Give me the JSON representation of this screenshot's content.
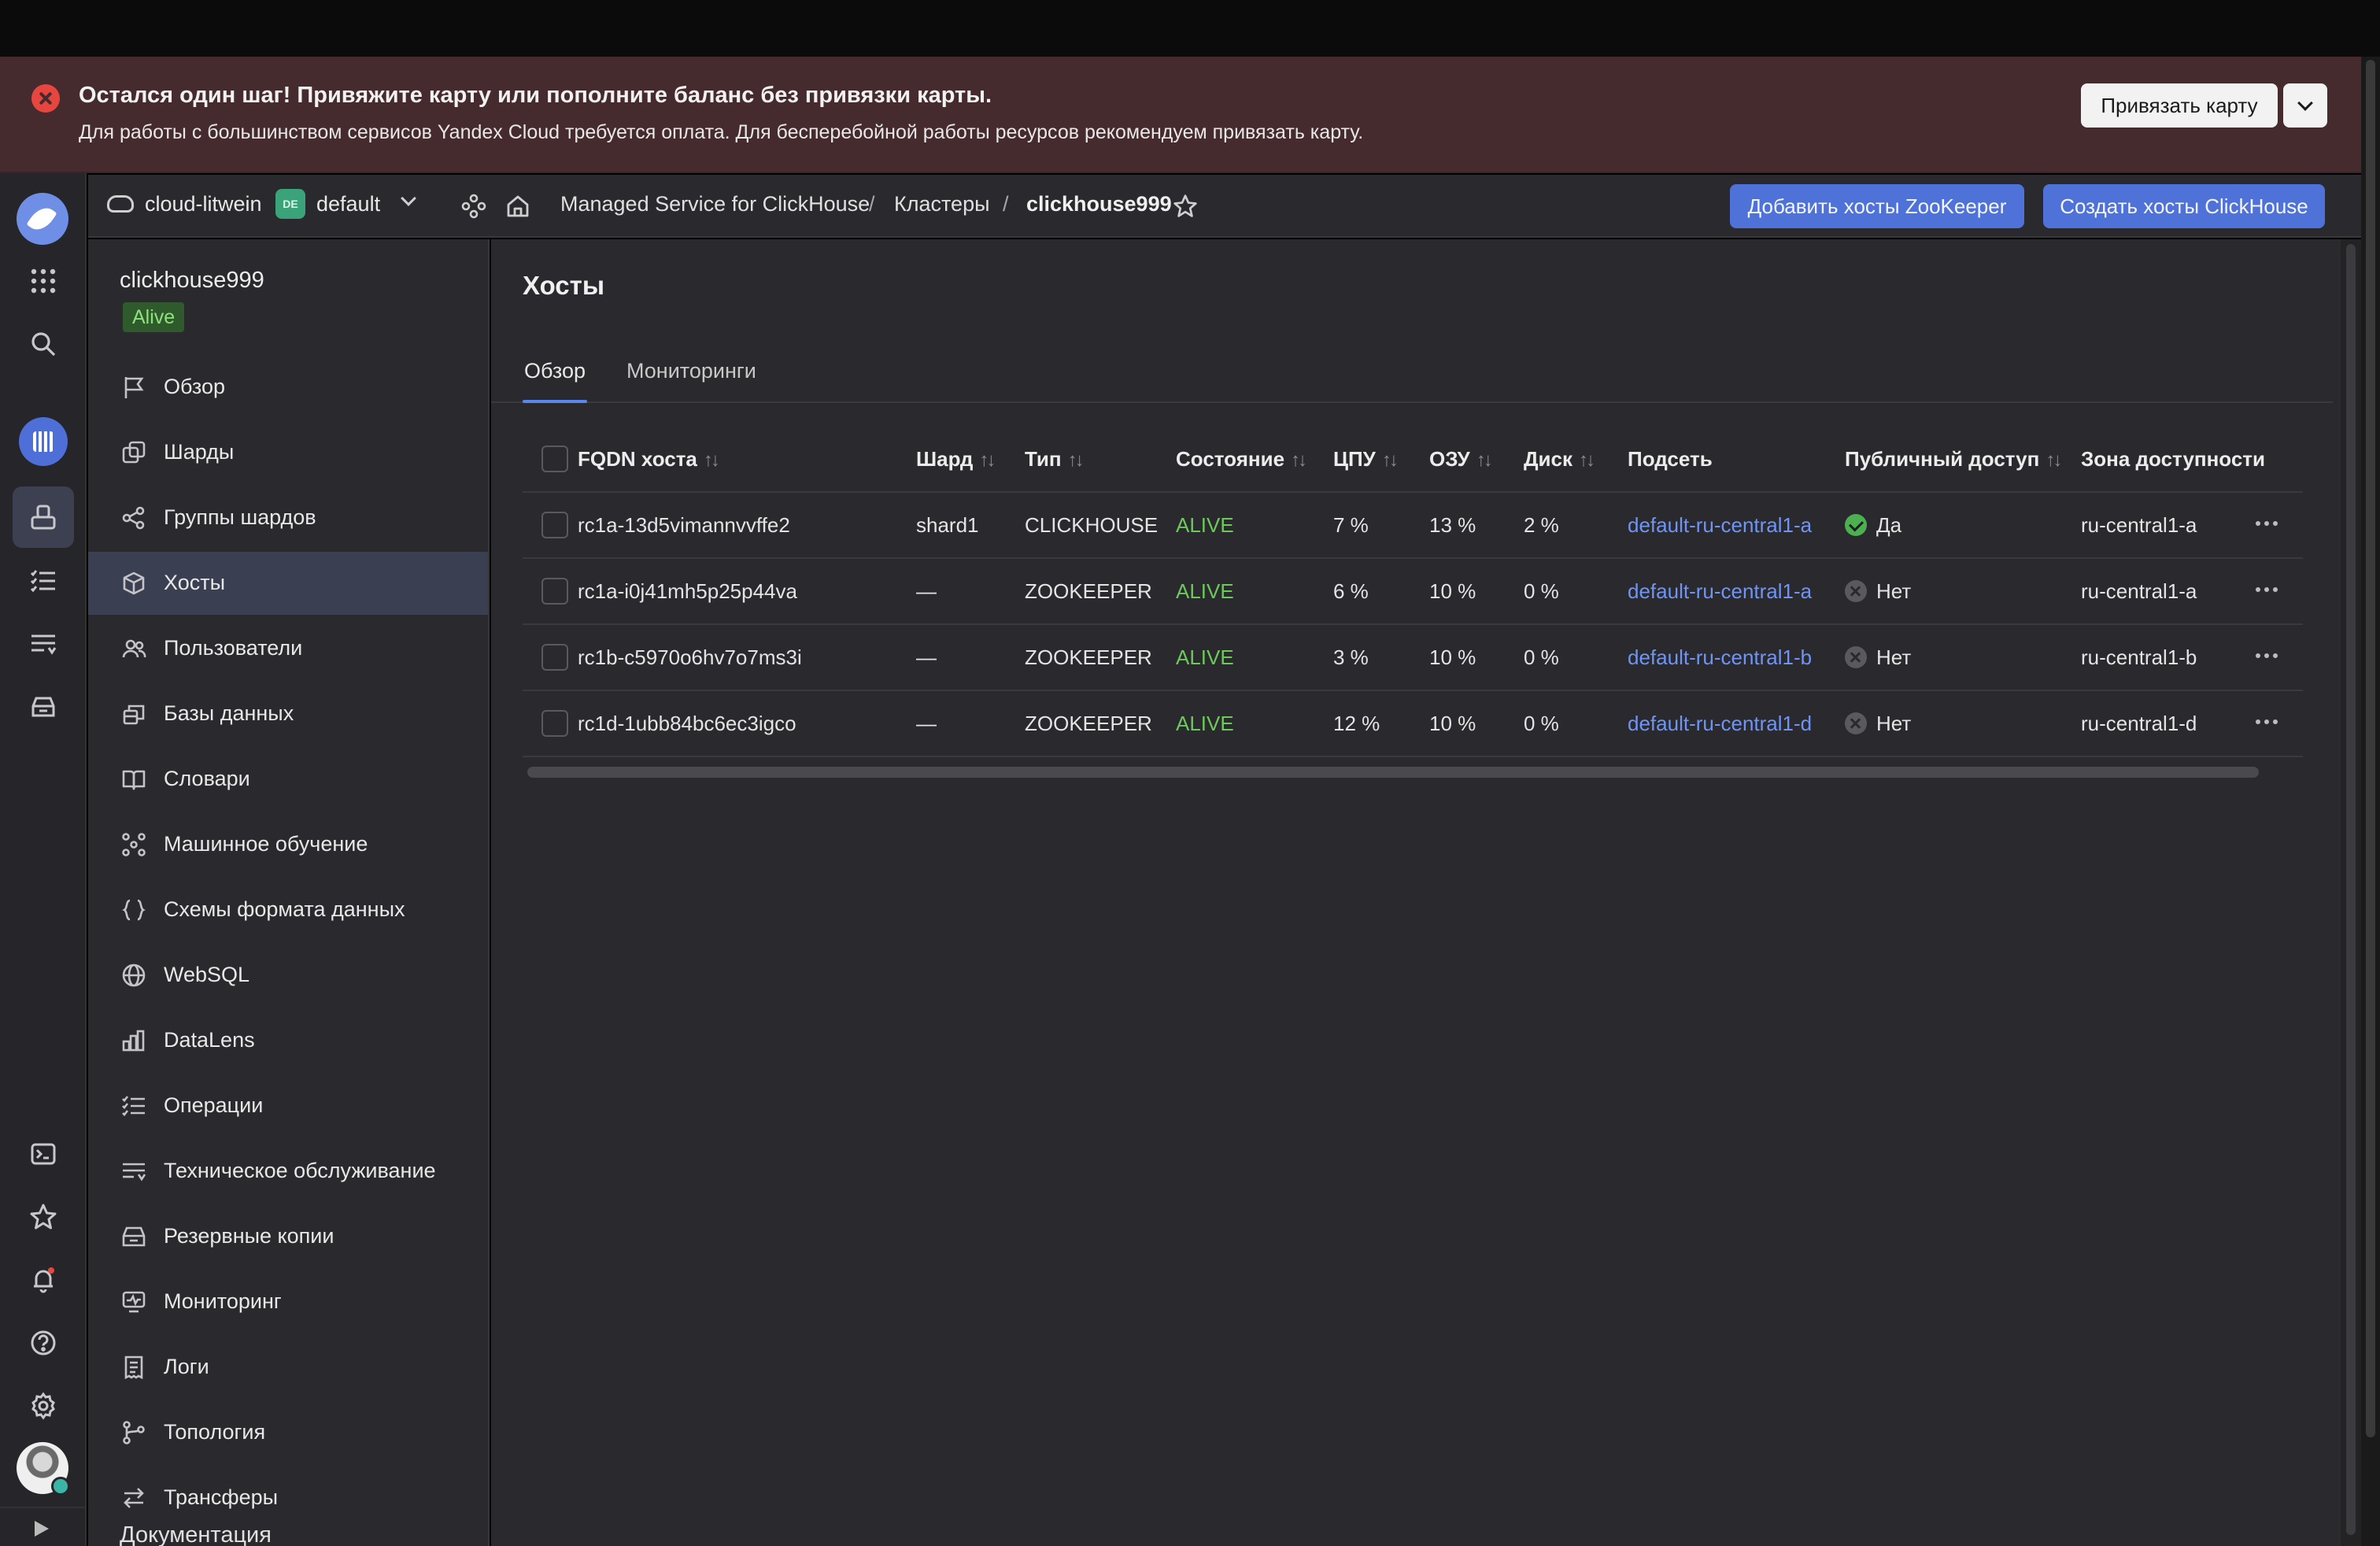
{
  "banner": {
    "title": "Остался один шаг! Привяжите карту или пополните баланс без привязки карты.",
    "text": "Для работы с большинством сервисов Yandex Cloud требуется оплата. Для бесперебойной работы ресурсов рекомендуем привязать карту.",
    "bind_card_label": "Привязать карту"
  },
  "header": {
    "cloud_name": "cloud-litwein",
    "folder_badge": "DE",
    "folder_name": "default",
    "breadcrumbs": [
      "Managed Service for ClickHouse",
      "Кластеры",
      "clickhouse999"
    ],
    "separator": "/",
    "add_zookeeper_label": "Добавить хосты ZooKeeper",
    "create_clickhouse_label": "Создать хосты ClickHouse"
  },
  "cluster": {
    "name": "clickhouse999",
    "status": "Alive"
  },
  "sidebar": {
    "items": [
      {
        "label": "Обзор",
        "icon": "flag-icon"
      },
      {
        "label": "Шарды",
        "icon": "shards-icon"
      },
      {
        "label": "Группы шардов",
        "icon": "shard-groups-icon"
      },
      {
        "label": "Хосты",
        "icon": "hosts-cube-icon",
        "active": true
      },
      {
        "label": "Пользователи",
        "icon": "users-icon"
      },
      {
        "label": "Базы данных",
        "icon": "databases-icon"
      },
      {
        "label": "Словари",
        "icon": "book-icon"
      },
      {
        "label": "Машинное обучение",
        "icon": "ml-icon"
      },
      {
        "label": "Схемы формата данных",
        "icon": "braces-icon"
      },
      {
        "label": "WebSQL",
        "icon": "globe-icon"
      },
      {
        "label": "DataLens",
        "icon": "bar-chart-icon"
      },
      {
        "label": "Операции",
        "icon": "list-icon"
      },
      {
        "label": "Техническое обслуживание",
        "icon": "maintenance-icon"
      },
      {
        "label": "Резервные копии",
        "icon": "backup-icon"
      },
      {
        "label": "Мониторинг",
        "icon": "monitor-icon"
      },
      {
        "label": "Логи",
        "icon": "logs-icon"
      },
      {
        "label": "Топология",
        "icon": "topology-icon"
      },
      {
        "label": "Трансферы",
        "icon": "transfer-icon"
      }
    ],
    "docs_label": "Документация"
  },
  "main": {
    "title": "Хосты",
    "tabs": [
      {
        "label": "Обзор",
        "active": true
      },
      {
        "label": "Мониторинги"
      }
    ]
  },
  "table": {
    "columns": [
      {
        "label": "FQDN хоста",
        "sortable": true
      },
      {
        "label": "Шард",
        "sortable": true
      },
      {
        "label": "Тип",
        "sortable": true
      },
      {
        "label": "Состояние",
        "sortable": true
      },
      {
        "label": "ЦПУ",
        "sortable": true
      },
      {
        "label": "ОЗУ",
        "sortable": true
      },
      {
        "label": "Диск",
        "sortable": true
      },
      {
        "label": "Подсеть",
        "sortable": false
      },
      {
        "label": "Публичный доступ",
        "sortable": true
      },
      {
        "label": "Зона доступности",
        "sortable": false
      }
    ],
    "rows": [
      {
        "fqdn": "rc1a-13d5vimannvvffe2",
        "shard": "shard1",
        "type": "CLICKHOUSE",
        "state": "ALIVE",
        "cpu": "7 %",
        "ram": "13 %",
        "disk": "2 %",
        "subnet": "default-ru-central1-a",
        "public": "Да",
        "public_yes": true,
        "zone": "ru-central1-a"
      },
      {
        "fqdn": "rc1a-i0j41mh5p25p44va",
        "shard": "—",
        "type": "ZOOKEEPER",
        "state": "ALIVE",
        "cpu": "6 %",
        "ram": "10 %",
        "disk": "0 %",
        "subnet": "default-ru-central1-a",
        "public": "Нет",
        "public_yes": false,
        "zone": "ru-central1-a"
      },
      {
        "fqdn": "rc1b-c5970o6hv7o7ms3i",
        "shard": "—",
        "type": "ZOOKEEPER",
        "state": "ALIVE",
        "cpu": "3 %",
        "ram": "10 %",
        "disk": "0 %",
        "subnet": "default-ru-central1-b",
        "public": "Нет",
        "public_yes": false,
        "zone": "ru-central1-b"
      },
      {
        "fqdn": "rc1d-1ubb84bc6ec3igco",
        "shard": "—",
        "type": "ZOOKEEPER",
        "state": "ALIVE",
        "cpu": "12 %",
        "ram": "10 %",
        "disk": "0 %",
        "subnet": "default-ru-central1-d",
        "public": "Нет",
        "public_yes": false,
        "zone": "ru-central1-d"
      }
    ]
  },
  "colors": {
    "accent": "#4f72d9",
    "alive": "#6cc95a",
    "link": "#6e95f5",
    "banner_bg": "#452b2e",
    "error": "#e6463e"
  }
}
